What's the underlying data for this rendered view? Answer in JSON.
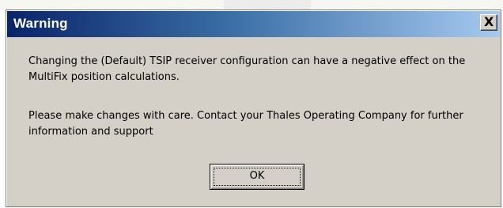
{
  "window": {
    "title": "Warning",
    "close_glyph": "X",
    "close_icon": "close-icon"
  },
  "message": {
    "paragraph1": "Changing the (Default) TSIP receiver configuration can have a negative effect on the MultiFix position calculations.",
    "paragraph2": "Please make changes with care. Contact your Thales Operating Company for further information and support"
  },
  "buttons": {
    "ok_label": "OK"
  },
  "colors": {
    "titlebar_start": "#0a246a",
    "titlebar_end": "#a6caf0",
    "dialog_face": "#d4d0c8"
  }
}
